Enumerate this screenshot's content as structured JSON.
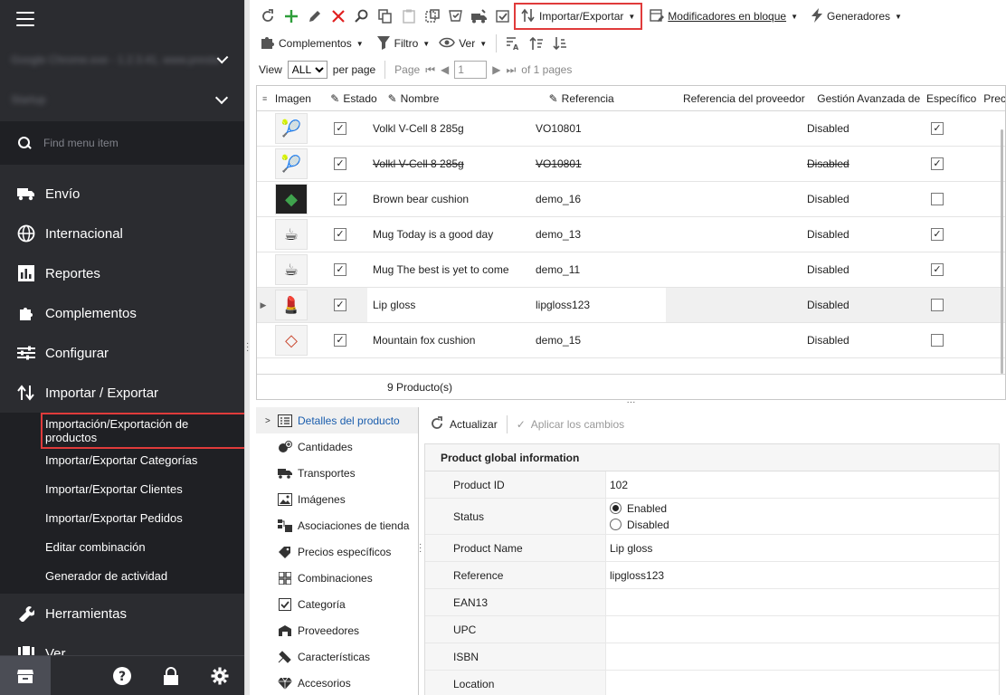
{
  "sidebar": {
    "account_blur": "Google Chrome.exe - 1.2.3.41, www.prestashop.com - 1.7",
    "shop_blur": "Startup",
    "search_placeholder": "Find menu item",
    "items": [
      {
        "label": "Envío",
        "icon": "truck-icon"
      },
      {
        "label": "Internacional",
        "icon": "globe-icon"
      },
      {
        "label": "Reportes",
        "icon": "bar-chart-icon"
      },
      {
        "label": "Complementos",
        "icon": "puzzle-icon"
      },
      {
        "label": "Configurar",
        "icon": "sliders-icon"
      },
      {
        "label": "Importar / Exportar",
        "icon": "import-export-icon"
      }
    ],
    "submenu": [
      "Importación/Exportación de productos",
      "Importar/Exportar Categorías",
      "Importar/Exportar Clientes",
      "Importar/Exportar Pedidos",
      "Editar combinación",
      "Generador de actividad"
    ],
    "items_after": [
      {
        "label": "Herramientas",
        "icon": "wrench-icon"
      },
      {
        "label": "Ver",
        "icon": "view-icon"
      }
    ]
  },
  "toolbar": {
    "import_export": "Importar/Exportar",
    "bulk": "Modificadores en bloque",
    "generators": "Generadores",
    "addons": "Complementos",
    "filter": "Filtro",
    "view": "Ver"
  },
  "pager": {
    "view_label": "View",
    "view_value": "ALL",
    "per_page": "per page",
    "page_label": "Page",
    "page_value": "1",
    "of_pages": "of 1 pages"
  },
  "grid": {
    "headers": {
      "imagen": "Imagen",
      "estado": "Estado",
      "nombre": "Nombre",
      "referencia": "Referencia",
      "proveedor": "Referencia del proveedor",
      "gestion": "Gestión Avanzada de",
      "especifico": "Específico",
      "precio": "Prec"
    },
    "rows": [
      {
        "name": "Volkl V-Cell 8 285g",
        "ref": "VO10801",
        "gestion": "Disabled",
        "esp": "✓",
        "est": "✓",
        "thumb": "🎾"
      },
      {
        "name": "Volkl V-Cell 8 285g",
        "ref": "VO10801",
        "gestion": "Disabled",
        "esp": "✓",
        "est": "✓",
        "thumb": "🎾"
      },
      {
        "name": "Brown bear cushion",
        "ref": "demo_16",
        "gestion": "Disabled",
        "esp": "",
        "est": "✓",
        "thumb": "◆"
      },
      {
        "name": "Mug Today is a good day",
        "ref": "demo_13",
        "gestion": "Disabled",
        "esp": "✓",
        "est": "✓",
        "thumb": "☕"
      },
      {
        "name": "Mug The best is yet to come",
        "ref": "demo_11",
        "gestion": "Disabled",
        "esp": "✓",
        "est": "✓",
        "thumb": "☕"
      },
      {
        "name": "Lip gloss",
        "ref": "lipgloss123",
        "gestion": "Disabled",
        "esp": "",
        "est": "✓",
        "thumb": "💄"
      },
      {
        "name": "Mountain fox cushion",
        "ref": "demo_15",
        "gestion": "Disabled",
        "esp": "",
        "est": "✓",
        "thumb": "◇"
      }
    ],
    "footer": "9 Producto(s)"
  },
  "tree": [
    {
      "label": "Detalles del producto",
      "icon": "list-icon"
    },
    {
      "label": "Cantidades",
      "icon": "quantities-icon"
    },
    {
      "label": "Transportes",
      "icon": "truck-icon"
    },
    {
      "label": "Imágenes",
      "icon": "image-icon"
    },
    {
      "label": "Asociaciones de tienda",
      "icon": "store-assoc-icon"
    },
    {
      "label": "Precios específicos",
      "icon": "price-tag-icon"
    },
    {
      "label": "Combinaciones",
      "icon": "grid-icon"
    },
    {
      "label": "Categoría",
      "icon": "category-check-icon"
    },
    {
      "label": "Proveedores",
      "icon": "supplier-icon"
    },
    {
      "label": "Características",
      "icon": "features-icon"
    },
    {
      "label": "Accesorios",
      "icon": "diamond-icon"
    }
  ],
  "detail": {
    "refresh": "Actualizar",
    "apply": "Aplicar los cambios",
    "title": "Product global information",
    "fields": {
      "id_label": "Product ID",
      "id_value": "102",
      "status_label": "Status",
      "enabled": "Enabled",
      "disabled": "Disabled",
      "name_label": "Product Name",
      "name_value": "Lip gloss",
      "ref_label": "Reference",
      "ref_value": "lipgloss123",
      "ean_label": "EAN13",
      "upc_label": "UPC",
      "isbn_label": "ISBN",
      "location_label": "Location"
    }
  }
}
